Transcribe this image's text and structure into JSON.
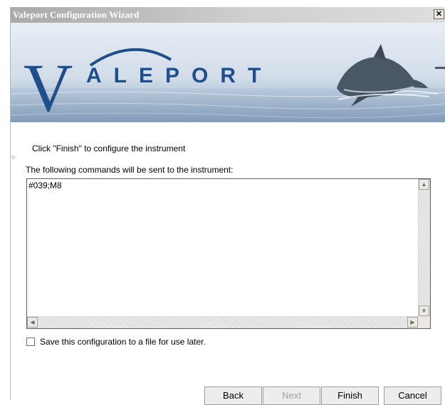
{
  "window": {
    "title": "Valeport Configuration Wizard",
    "close_label": "✕"
  },
  "banner": {
    "logo_first": "V",
    "logo_rest": "ALEPORT"
  },
  "content": {
    "finish_hint": "Click \"Finish\" to configure the instrument",
    "commands_label": "The following commands will be sent to the instrument:",
    "commands_text": "#039;M8",
    "save_checkbox_label": "Save this configuration to a file for use later.",
    "save_checked": false
  },
  "buttons": {
    "back": "Back",
    "next": "Next",
    "finish": "Finish",
    "cancel": "Cancel"
  },
  "colors": {
    "logo_blue": "#1f4e8c",
    "title_bar": "#a9a9a9"
  }
}
